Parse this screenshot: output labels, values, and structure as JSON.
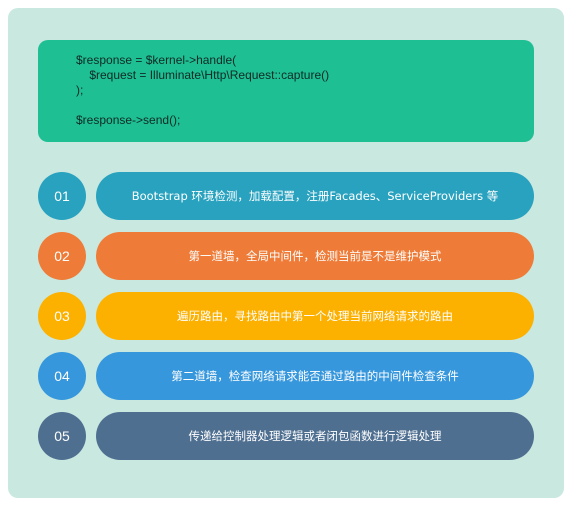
{
  "code": {
    "lines": [
      "$response = $kernel->handle(",
      "    $request = Illuminate\\Http\\Request::capture()",
      ");",
      "",
      "$response->send();"
    ]
  },
  "steps": [
    {
      "number": "01",
      "text": "Bootstrap 环境检测，加载配置，注册Facades、ServiceProviders 等",
      "color": "#28a2bf"
    },
    {
      "number": "02",
      "text": "第一道墙，全局中间件，检测当前是不是维护模式",
      "color": "#ee7b37"
    },
    {
      "number": "03",
      "text": "遍历路由，寻找路由中第一个处理当前网络请求的路由",
      "color": "#fcb000"
    },
    {
      "number": "04",
      "text": "第二道墙，检查网络请求能否通过路由的中间件检查条件",
      "color": "#3797dc"
    },
    {
      "number": "05",
      "text": "传递给控制器处理逻辑或者闭包函数进行逻辑处理",
      "color": "#4f6f91"
    }
  ]
}
